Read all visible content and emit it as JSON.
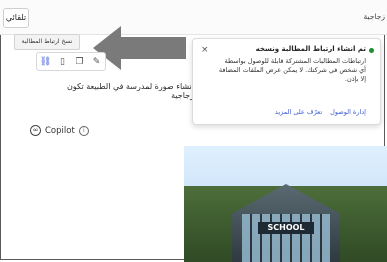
{
  "header": {
    "auto_label": "تلقائي",
    "title": "زجاجية"
  },
  "tooltip": {
    "text": "نسخ ارتباط المطالبة"
  },
  "prompt": {
    "text": "انشاء صورة لمدرسة في الطبيعة تكون زجاجية"
  },
  "assistant": {
    "name": "Copilot",
    "info_icon": "info-icon"
  },
  "toast": {
    "title": "تم انشاء ارتباط المطالبة ونسخه",
    "body": "ارتباطات المطالبات المشتركة قابلة للوصول بواسطة أي شخص في شركتك. لا يمكن عرض الملفات المضافة إلا بإذن.",
    "link_manage": "إدارة الوصول",
    "link_learn": "تعرّف على المزيد",
    "close": "×",
    "status_color": "#1f8f32"
  },
  "image": {
    "sign_text": "SCHOOL"
  },
  "colors": {
    "accent": "#3b5bd6",
    "arrow": "#7a7a7a"
  }
}
